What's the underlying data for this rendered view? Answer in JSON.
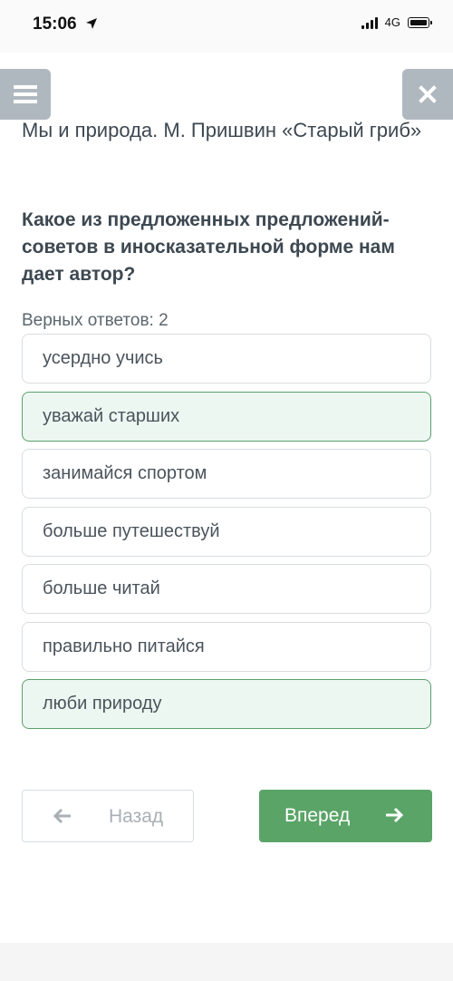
{
  "status_bar": {
    "time": "15:06",
    "network": "4G",
    "icons": [
      "location-arrow-icon",
      "signal-icon",
      "battery-icon"
    ]
  },
  "toolbar": {
    "menu_icon": "hamburger-icon",
    "close_icon": "close-icon"
  },
  "lesson": {
    "title": "Мы и природа. М. Пришвин «Старый гриб»"
  },
  "question": {
    "text": "Какое из предложенных предложений-советов в иносказательной форме нам дает автор?",
    "answers_count": "Верных ответов: 2",
    "options": [
      {
        "label": "усердно учись",
        "selected": false
      },
      {
        "label": "уважай старших",
        "selected": true
      },
      {
        "label": "занимайся спортом",
        "selected": false
      },
      {
        "label": "больше путешествуй",
        "selected": false
      },
      {
        "label": "больше читай",
        "selected": false
      },
      {
        "label": "правильно питайся",
        "selected": false
      },
      {
        "label": "люби природу",
        "selected": true
      }
    ]
  },
  "navigation": {
    "back_label": "Назад",
    "next_label": "Вперед"
  },
  "colors": {
    "accent_green": "#5aa467",
    "selected_background": "#edf7f1",
    "header_button_gray": "#b0b8bf"
  }
}
